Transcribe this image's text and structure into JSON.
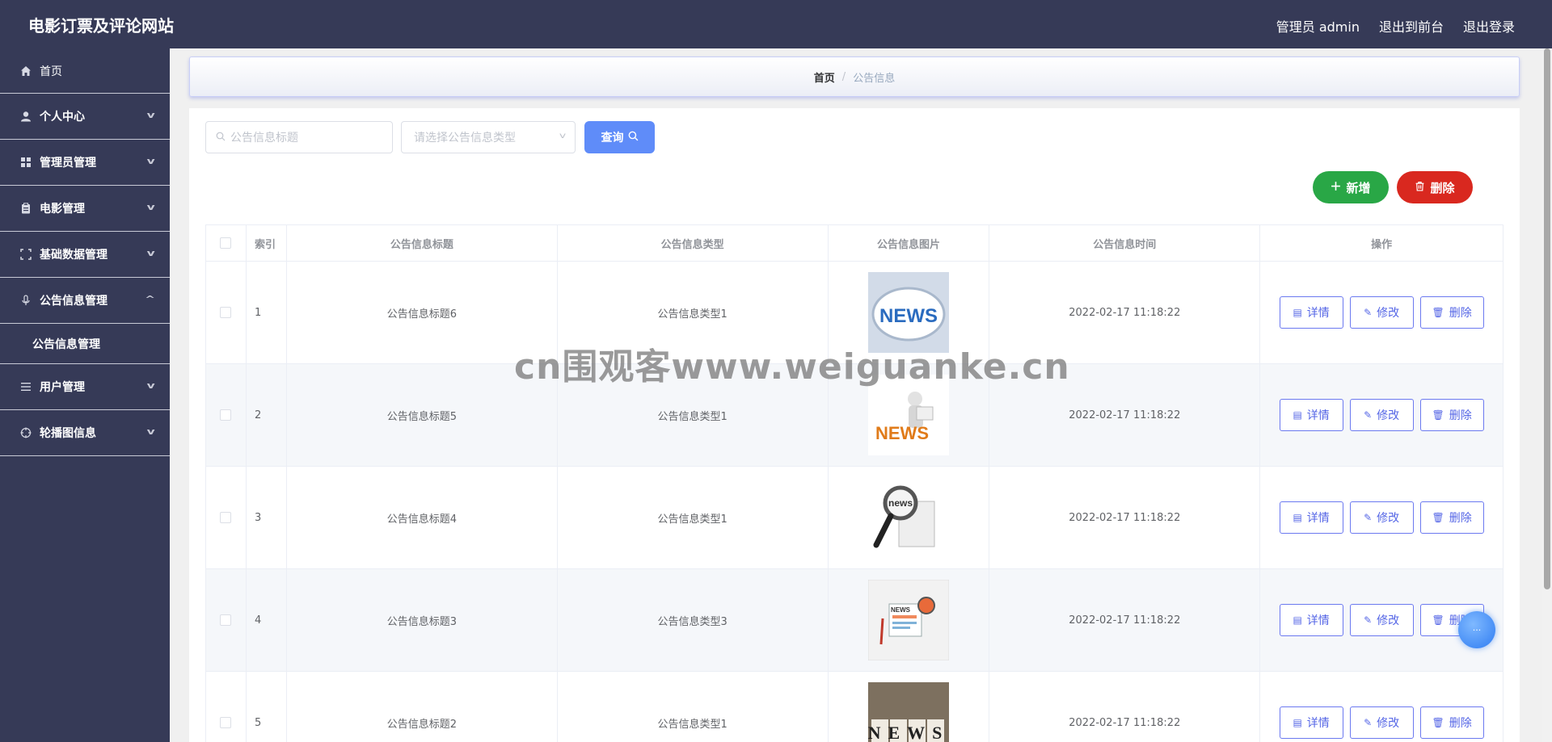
{
  "header": {
    "site_title": "电影订票及评论网站",
    "admin_label": "管理员 admin",
    "to_front": "退出到前台",
    "logout": "退出登录"
  },
  "sidebar": {
    "items": [
      {
        "label": "首页",
        "icon": "home-icon"
      },
      {
        "label": "个人中心",
        "icon": "user-icon"
      },
      {
        "label": "管理员管理",
        "icon": "grid-icon"
      },
      {
        "label": "电影管理",
        "icon": "clipboard-icon"
      },
      {
        "label": "基础数据管理",
        "icon": "frame-icon"
      },
      {
        "label": "公告信息管理",
        "icon": "microphone-icon"
      },
      {
        "label": "用户管理",
        "icon": "list-icon"
      },
      {
        "label": "轮播图信息",
        "icon": "target-icon"
      }
    ],
    "submenu": {
      "label": "公告信息管理"
    }
  },
  "breadcrumb": {
    "home": "首页",
    "separator": "/",
    "current": "公告信息"
  },
  "search": {
    "title_placeholder": "公告信息标题",
    "type_placeholder": "请选择公告信息类型",
    "query_label": "查询"
  },
  "actions": {
    "add_label": "新增",
    "delete_label": "删除"
  },
  "table": {
    "headers": [
      "索引",
      "公告信息标题",
      "公告信息类型",
      "公告信息图片",
      "公告信息时间",
      "操作"
    ],
    "rows": [
      {
        "index": "1",
        "title": "公告信息标题6",
        "type": "公告信息类型1",
        "image_text": "NEWS",
        "time": "2022-02-17 11:18:22"
      },
      {
        "index": "2",
        "title": "公告信息标题5",
        "type": "公告信息类型1",
        "image_text": "NEWS",
        "time": "2022-02-17 11:18:22"
      },
      {
        "index": "3",
        "title": "公告信息标题4",
        "type": "公告信息类型1",
        "image_text": "news",
        "time": "2022-02-17 11:18:22"
      },
      {
        "index": "4",
        "title": "公告信息标题3",
        "type": "公告信息类型3",
        "image_text": "NEWS",
        "time": "2022-02-17 11:18:22"
      },
      {
        "index": "5",
        "title": "公告信息标题2",
        "type": "公告信息类型1",
        "image_text": "NEWS",
        "time": "2022-02-17 11:18:22"
      }
    ],
    "op_labels": {
      "detail": "详情",
      "edit": "修改",
      "delete": "删除"
    }
  },
  "watermark": "cn围观客www.weiguanke.cn",
  "colors": {
    "header_bg": "#363a57",
    "primary": "#5f8cf9",
    "success": "#29a746",
    "danger": "#d9281f",
    "op_border": "#6b79f0"
  }
}
